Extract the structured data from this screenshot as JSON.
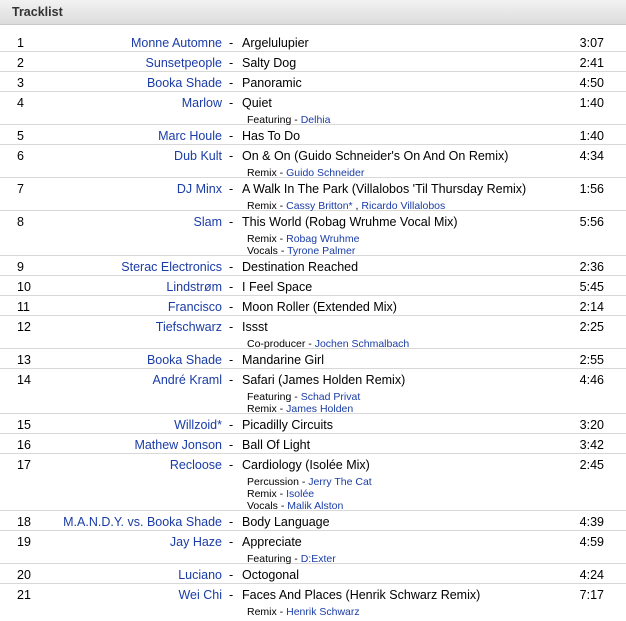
{
  "header": {
    "title": "Tracklist"
  },
  "tracks": [
    {
      "num": "1",
      "artist": "Monne Automne",
      "title": "Argelulupier",
      "duration": "3:07",
      "credits": []
    },
    {
      "num": "2",
      "artist": "Sunsetpeople",
      "title": "Salty Dog",
      "duration": "2:41",
      "credits": []
    },
    {
      "num": "3",
      "artist": "Booka Shade",
      "title": "Panoramic",
      "duration": "4:50",
      "credits": []
    },
    {
      "num": "4",
      "artist": "Marlow",
      "title": "Quiet",
      "duration": "1:40",
      "credits": [
        {
          "role": "Featuring",
          "names": [
            "Delhia"
          ]
        }
      ]
    },
    {
      "num": "5",
      "artist": "Marc Houle",
      "title": "Has To Do",
      "duration": "1:40",
      "credits": []
    },
    {
      "num": "6",
      "artist": "Dub Kult",
      "title": "On & On (Guido Schneider's On And On Remix)",
      "duration": "4:34",
      "credits": [
        {
          "role": "Remix",
          "names": [
            "Guido Schneider"
          ]
        }
      ]
    },
    {
      "num": "7",
      "artist": "DJ Minx",
      "title": "A Walk In The Park (Villalobos 'Til Thursday Remix)",
      "duration": "1:56",
      "credits": [
        {
          "role": "Remix",
          "names": [
            "Cassy Britton*",
            "Ricardo Villalobos"
          ]
        }
      ]
    },
    {
      "num": "8",
      "artist": "Slam",
      "title": "This World (Robag Wruhme Vocal Mix)",
      "duration": "5:56",
      "credits": [
        {
          "role": "Remix",
          "names": [
            "Robag Wruhme"
          ]
        },
        {
          "role": "Vocals",
          "names": [
            "Tyrone Palmer"
          ]
        }
      ]
    },
    {
      "num": "9",
      "artist": "Sterac Electronics",
      "title": "Destination Reached",
      "duration": "2:36",
      "credits": []
    },
    {
      "num": "10",
      "artist": "Lindstrøm",
      "title": "I Feel Space",
      "duration": "5:45",
      "credits": []
    },
    {
      "num": "11",
      "artist": "Francisco",
      "title": "Moon Roller (Extended Mix)",
      "duration": "2:14",
      "credits": []
    },
    {
      "num": "12",
      "artist": "Tiefschwarz",
      "title": "Issst",
      "duration": "2:25",
      "credits": [
        {
          "role": "Co-producer",
          "names": [
            "Jochen Schmalbach"
          ]
        }
      ]
    },
    {
      "num": "13",
      "artist": "Booka Shade",
      "title": "Mandarine Girl",
      "duration": "2:55",
      "credits": []
    },
    {
      "num": "14",
      "artist": "André Kraml",
      "title": "Safari (James Holden Remix)",
      "duration": "4:46",
      "credits": [
        {
          "role": "Featuring",
          "names": [
            "Schad Privat"
          ]
        },
        {
          "role": "Remix",
          "names": [
            "James Holden"
          ]
        }
      ]
    },
    {
      "num": "15",
      "artist": "Willzoid*",
      "title": "Picadilly Circuits",
      "duration": "3:20",
      "credits": []
    },
    {
      "num": "16",
      "artist": "Mathew Jonson",
      "title": "Ball Of Light",
      "duration": "3:42",
      "credits": []
    },
    {
      "num": "17",
      "artist": "Recloose",
      "title": "Cardiology (Isolée Mix)",
      "duration": "2:45",
      "credits": [
        {
          "role": "Percussion",
          "names": [
            "Jerry The Cat"
          ]
        },
        {
          "role": "Remix",
          "names": [
            "Isolée"
          ]
        },
        {
          "role": "Vocals",
          "names": [
            "Malik Alston"
          ]
        }
      ]
    },
    {
      "num": "18",
      "artist": "M.A.N.D.Y. vs. Booka Shade",
      "title": "Body Language",
      "duration": "4:39",
      "credits": []
    },
    {
      "num": "19",
      "artist": "Jay Haze",
      "title": "Appreciate",
      "duration": "4:59",
      "credits": [
        {
          "role": "Featuring",
          "names": [
            "D:Exter"
          ]
        }
      ]
    },
    {
      "num": "20",
      "artist": "Luciano",
      "title": "Octogonal",
      "duration": "4:24",
      "credits": []
    },
    {
      "num": "21",
      "artist": "Wei Chi",
      "title": "Faces And Places (Henrik Schwarz Remix)",
      "duration": "7:17",
      "credits": [
        {
          "role": "Remix",
          "names": [
            "Henrik Schwarz"
          ]
        }
      ]
    }
  ]
}
